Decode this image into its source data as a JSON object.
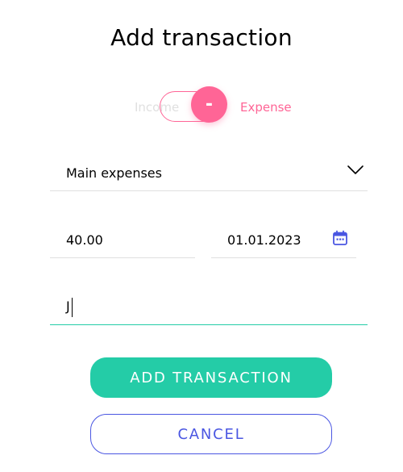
{
  "modal": {
    "title": "Add transaction"
  },
  "toggle": {
    "income_label": "Income",
    "expense_label": "Expense",
    "knob_symbol": "-",
    "selected": "Expense"
  },
  "form": {
    "category": {
      "value": "Main expenses",
      "icon": "chevron-down-icon"
    },
    "amount": {
      "value": "40.00"
    },
    "date": {
      "value": "01.01.2023",
      "icon": "calendar-icon"
    },
    "comment": {
      "value": "J"
    }
  },
  "buttons": {
    "add_label": "ADD TRANSACTION",
    "cancel_label": "CANCEL"
  },
  "colors": {
    "accent_green": "#24cca7",
    "accent_pink": "#ff6596",
    "accent_blue": "#4a56e2",
    "muted_gray": "#e0e0e0"
  }
}
